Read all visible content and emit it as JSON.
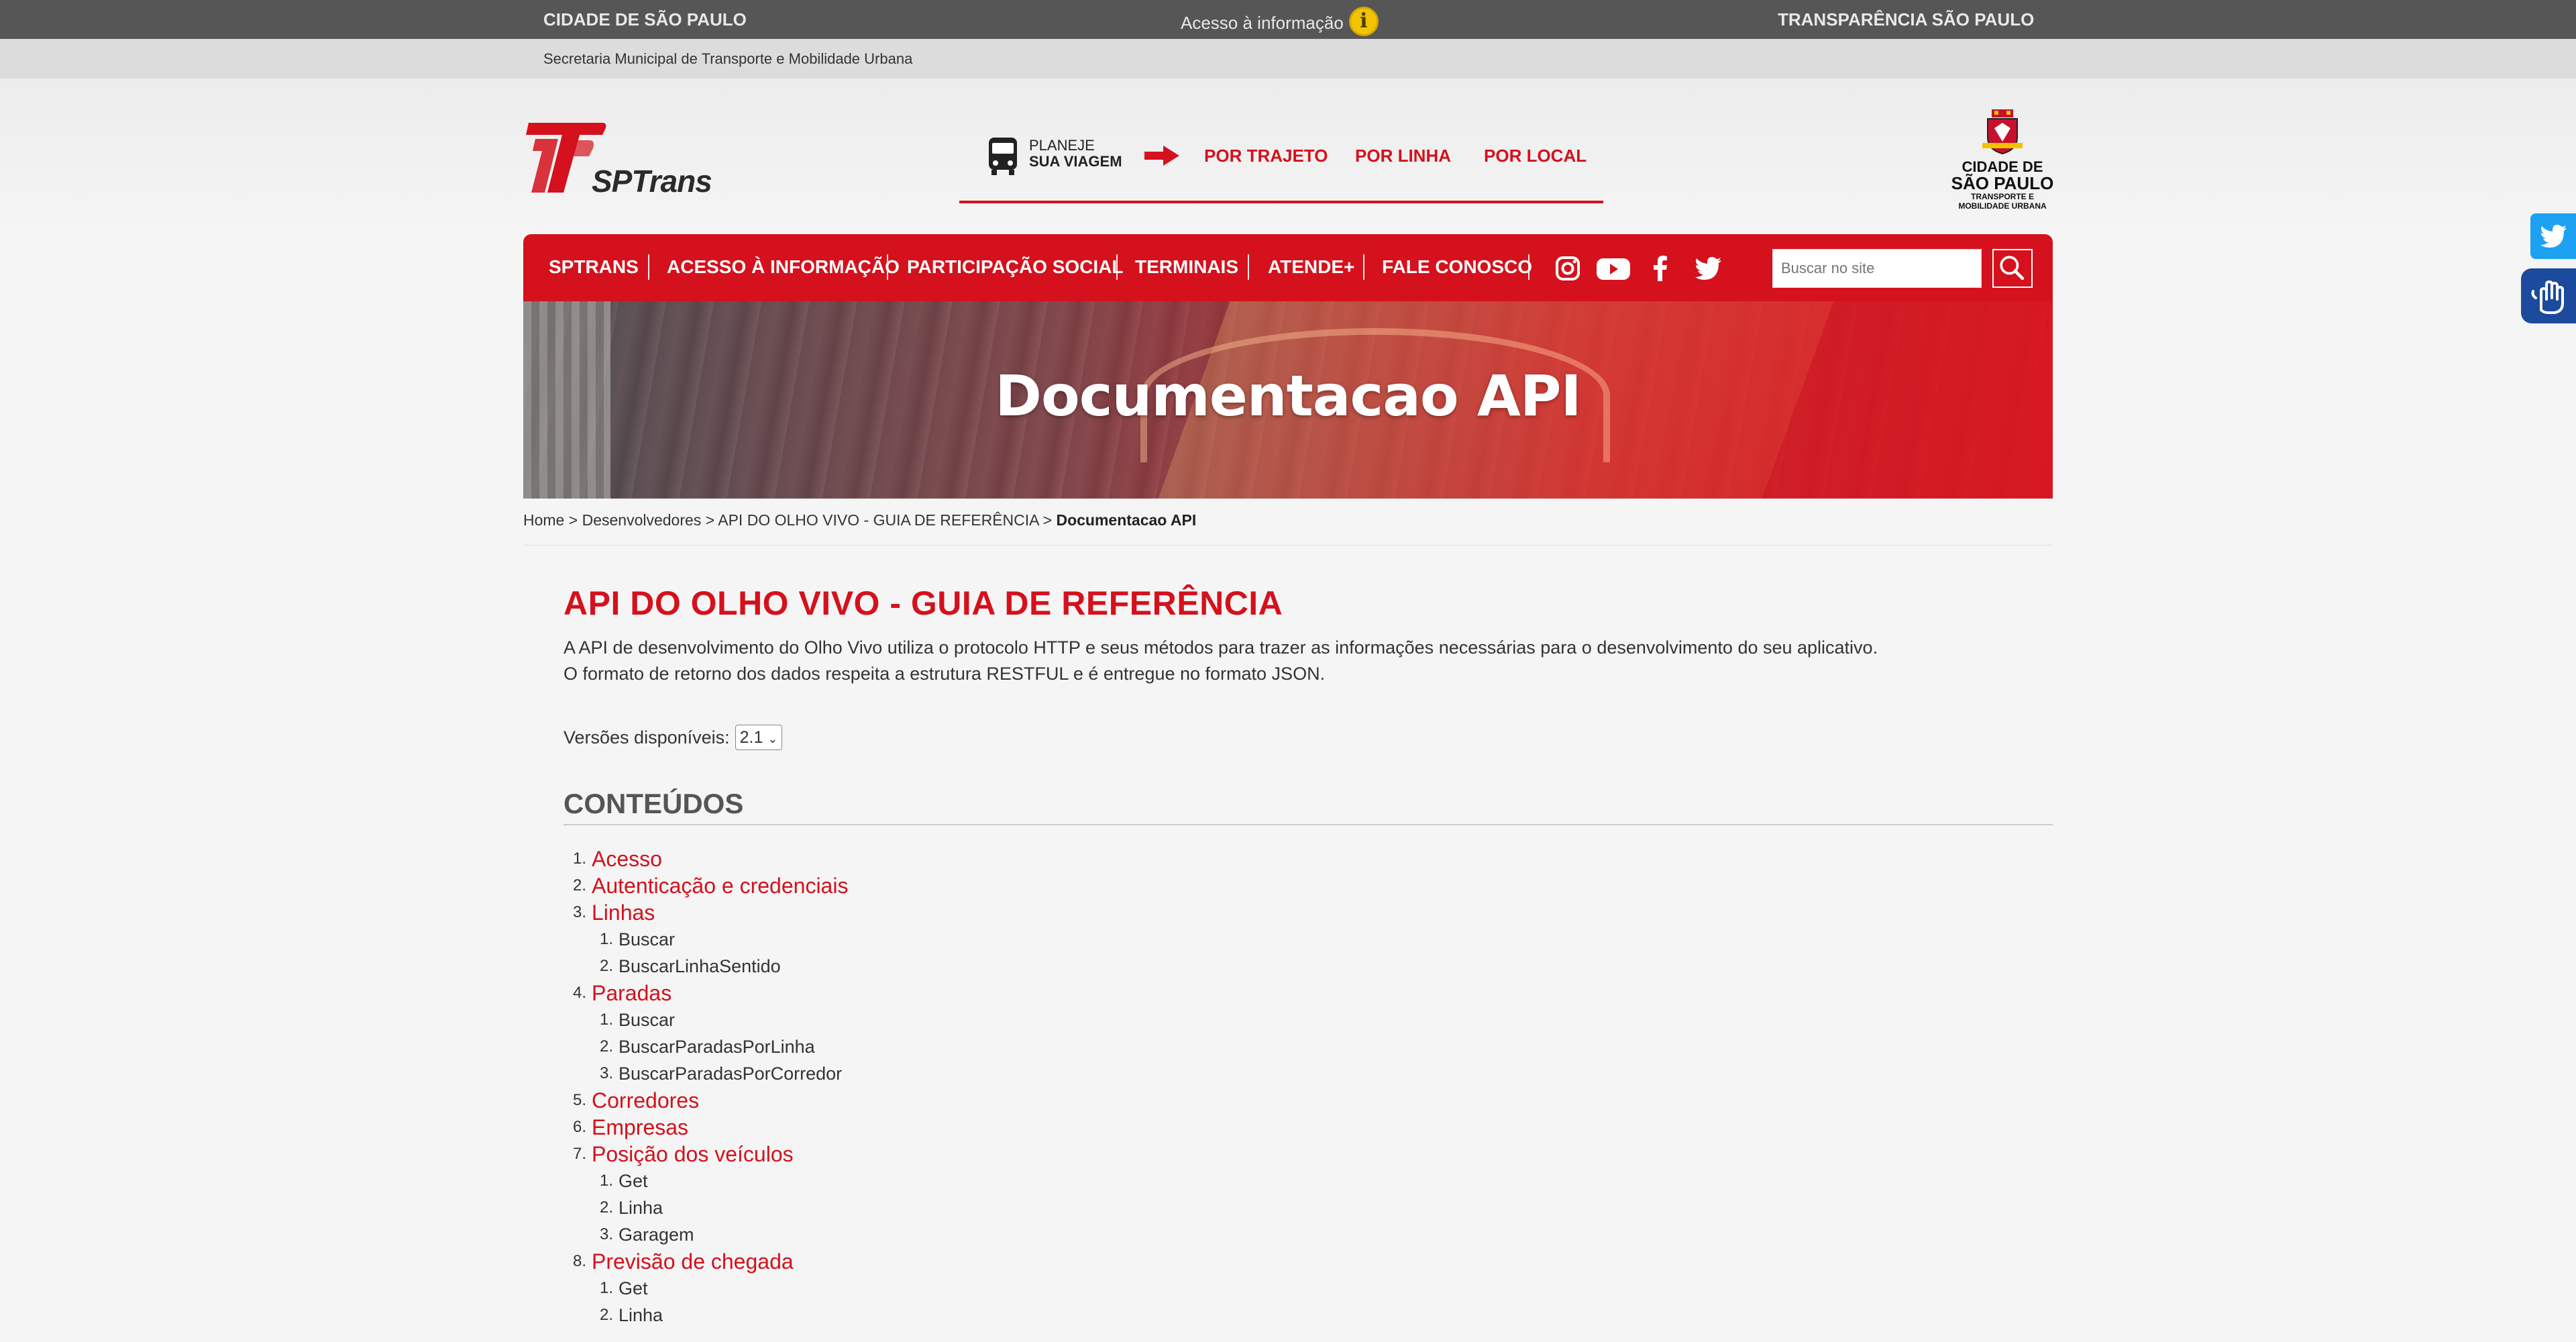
{
  "gov_bar": {
    "left": "CIDADE DE SÃO PAULO",
    "center": "Acesso à informação",
    "right": "TRANSPARÊNCIA SÃO PAULO"
  },
  "sec_bar": "Secretaria Municipal de Transporte e Mobilidade Urbana",
  "logo": {
    "name": "SPTrans"
  },
  "planeje": {
    "line1": "PLANEJE",
    "line2": "SUA VIAGEM",
    "links": [
      "POR TRAJETO",
      "POR LINHA",
      "POR LOCAL"
    ]
  },
  "city_logo": {
    "line1": "CIDADE DE",
    "line2": "SÃO PAULO",
    "line3": "TRANSPORTE E",
    "line4": "MOBILIDADE URBANA"
  },
  "nav": {
    "items": [
      "SPTRANS",
      "ACESSO À INFORMAÇÃO",
      "PARTICIPAÇÃO SOCIAL",
      "TERMINAIS",
      "ATENDE+",
      "FALE CONOSCO"
    ],
    "search_placeholder": "Buscar no site"
  },
  "hero": {
    "title": "Documentacao API"
  },
  "breadcrumb": {
    "items": [
      "Home",
      "Desenvolvedores",
      "API DO OLHO VIVO - GUIA DE REFERÊNCIA"
    ],
    "current": "Documentacao API",
    "separator": ">"
  },
  "content": {
    "title": "API DO OLHO VIVO - GUIA DE REFERÊNCIA",
    "intro1": "A API de desenvolvimento do Olho Vivo utiliza o protocolo HTTP e seus métodos para trazer as informações necessárias para o desenvolvimento do seu aplicativo.",
    "intro2": "O formato de retorno dos dados respeita a estrutura RESTFUL e é entregue no formato JSON.",
    "versions_label": "Versões disponíveis:",
    "versions_selected": "2.1",
    "contents_title": "CONTEÚDOS"
  },
  "toc": [
    {
      "num": "1.",
      "label": "Acesso",
      "subs": []
    },
    {
      "num": "2.",
      "label": "Autenticação e credenciais",
      "subs": []
    },
    {
      "num": "3.",
      "label": "Linhas",
      "subs": [
        "Buscar",
        "BuscarLinhaSentido"
      ]
    },
    {
      "num": "4.",
      "label": "Paradas",
      "subs": [
        "Buscar",
        "BuscarParadasPorLinha",
        "BuscarParadasPorCorredor"
      ]
    },
    {
      "num": "5.",
      "label": "Corredores",
      "subs": []
    },
    {
      "num": "6.",
      "label": "Empresas",
      "subs": []
    },
    {
      "num": "7.",
      "label": "Posição dos veículos",
      "subs": [
        "Get",
        "Linha",
        "Garagem"
      ]
    },
    {
      "num": "8.",
      "label": "Previsão de chegada",
      "subs": [
        "Get",
        "Linha"
      ]
    }
  ],
  "colors": {
    "brand_red": "#d4111c",
    "gov_bar": "#565656",
    "twitter": "#1da1f2",
    "accessibility": "#1c4a9c"
  }
}
